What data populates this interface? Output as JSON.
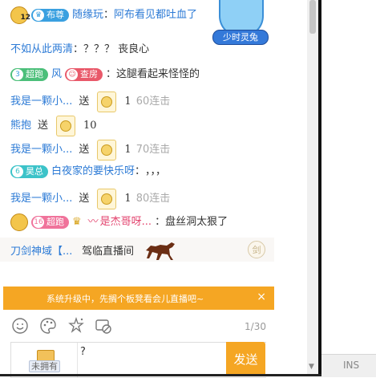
{
  "top_card": {
    "label": "少时灵兔"
  },
  "messages": [
    {
      "badge": "布尊",
      "badge_level": "12",
      "name": "随缘玩",
      "sep": "：",
      "text": "阿布看见都吐血了"
    },
    {
      "name": "不如从此两清",
      "sep": "：",
      "text": "？？？ 丧良心"
    },
    {
      "badge": "超跑",
      "badge_level": "3",
      "name": "风",
      "role": "查房",
      "sep": "：",
      "text": "这腿看起来怪怪的"
    },
    {
      "name": "我是一颗小...",
      "action": "送",
      "count": "1",
      "combo": "60连击"
    },
    {
      "name": "熊抱",
      "action": "送",
      "count": "10"
    },
    {
      "name": "我是一颗小...",
      "action": "送",
      "count": "1",
      "combo": "70连击"
    },
    {
      "badge": "昊总",
      "badge_level": "6",
      "name": "白夜家的要快乐呀",
      "sep": "：",
      "text": "，，，"
    },
    {
      "name": "我是一颗小...",
      "action": "送",
      "count": "1",
      "combo": "80连击"
    },
    {
      "badge": "超跑",
      "badge_level": "16",
      "name": "是杰哥呀...",
      "sep": "：",
      "text": "盘丝洞太狠了"
    }
  ],
  "broadcast": {
    "name": "刀剑神域【...",
    "text": "驾临直播间",
    "icon_label": "剑"
  },
  "notice": {
    "text": "系统升级中，先搁个板凳看会儿直播吧~",
    "close": "×"
  },
  "toolbar": {
    "counter": "1/30"
  },
  "bag": {
    "label": "未拥有"
  },
  "input": {
    "value": "?"
  },
  "send_label": "发送",
  "status": {
    "ins": "INS"
  },
  "colors": {
    "accent": "#f5a623",
    "name_blue": "#2d7bd6",
    "badge_pink": "#f0739b",
    "badge_blue": "#3aa0e0",
    "badge_teal": "#3cc3c9"
  },
  "icons": [
    "emoji-icon",
    "color-palette-icon",
    "effects-icon",
    "no-barrage-icon",
    "gift-icon",
    "close-icon",
    "horse-icon"
  ]
}
